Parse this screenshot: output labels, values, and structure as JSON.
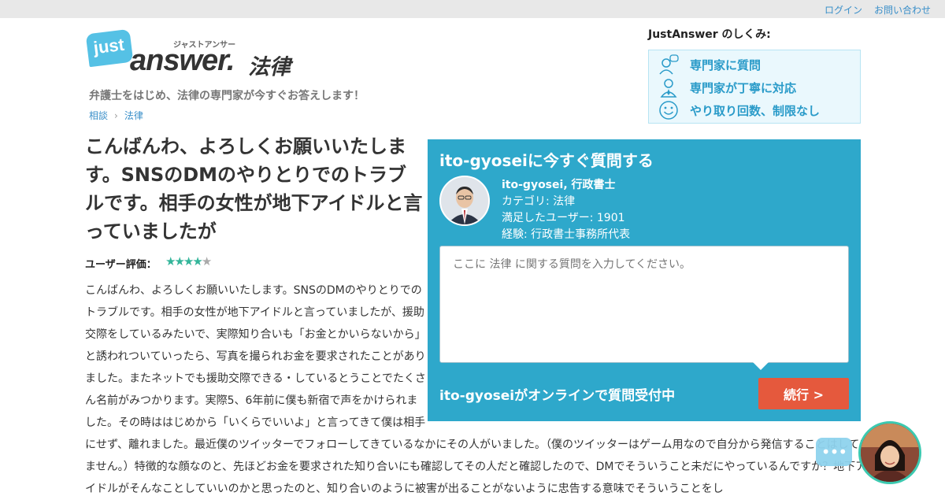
{
  "topbar": {
    "login": "ログイン",
    "contact": "お問い合わせ"
  },
  "logo": {
    "just": "just",
    "kana": "ジャストアンサー",
    "answer": "answer.",
    "category": "法律"
  },
  "tagline": "弁護士をはじめ、法律の専門家が今すぐお答えします！",
  "breadcrumb": {
    "items": [
      "相談",
      "法律"
    ],
    "separator": "›"
  },
  "how_it_works": {
    "title": "JustAnswer のしくみ:",
    "items": [
      {
        "icon": "question-person-icon",
        "label": "専門家に質問"
      },
      {
        "icon": "expert-icon",
        "label": "専門家が丁寧に対応"
      },
      {
        "icon": "smiley-icon",
        "label": "やり取り回数、制限なし"
      }
    ]
  },
  "question": {
    "title": "こんばんわ、よろしくお願いいたします。SNSのDMのやりとりでのトラブルです。相手の女性が地下アイドルと言っていましたが",
    "rating_label": "ユーザー評価：",
    "rating": 4,
    "rating_max": 5,
    "body": "こんばんわ、よろしくお願いいたします。SNSのDMのやりとりでのトラブルです。相手の女性が地下アイドルと言っていましたが、援助交際をしているみたいで、実際知り合いも「お金とかいらないから」と誘われついていったら、写真を撮られお金を要求されたことがありました。またネットでも援助交際できる・しているとうことでたくさん名前がみつかります。実際5、6年前に僕も新宿で声をかけられました。その時ははじめから「いくらでいいよ」と言ってきて僕は相手にせず、離れました。最近僕のツイッターでフォローしてきているなかにその人がいました。（僕のツイッターはゲーム用なので自分から発信することはしていません。）特徴的な顔なのと、先ほどお金を要求された知り合いにも確認してその人だと確認したので、DMでそういうこと未だにやっているんですか？地下アイドルがそんなことしていいのかと思ったのと、知り合いのように被害が出ることがないように忠告する意味でそういうことをし"
  },
  "expert_panel": {
    "title": "ito-gyoseiに今すぐ質問する",
    "name": "ito-gyosei, 行政書士",
    "category": "カテゴリ: 法律",
    "satisfied": "満足したユーザー: 1901",
    "experience": "経験:  行政書士事務所代表",
    "placeholder": "ここに 法律 に関する質問を入力してください。",
    "online_text": "ito-gyoseiがオンラインで質問受付中",
    "continue_label": "続行 >"
  },
  "chat": {
    "bubble_icon": "typing-dots-icon"
  },
  "colors": {
    "panel": "#2ea8cb",
    "accent_button": "#e5593d",
    "link": "#3a8fc9",
    "star": "#33b59a"
  }
}
